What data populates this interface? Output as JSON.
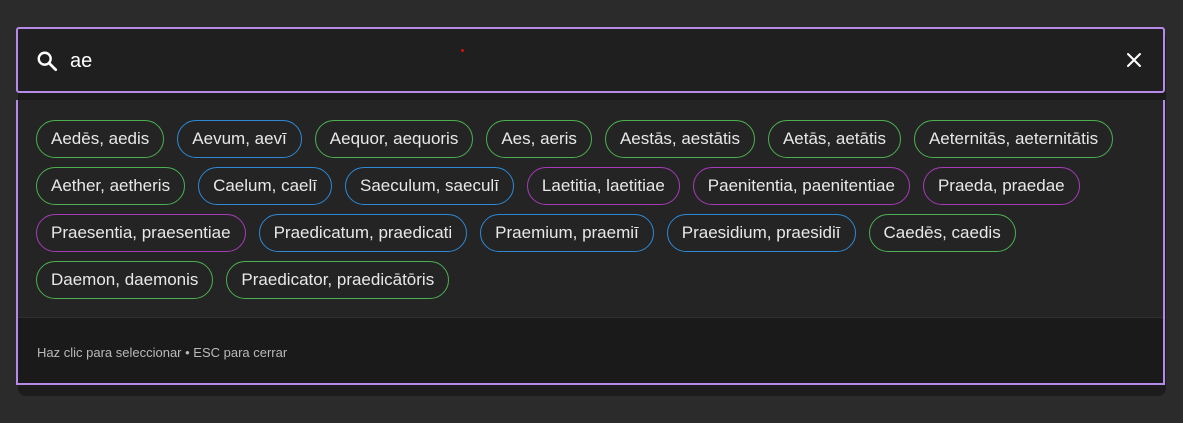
{
  "search": {
    "value": "ae",
    "placeholder": ""
  },
  "icons": {
    "search": "search-icon",
    "clear": "close-icon"
  },
  "colors": {
    "accent_border": "#b58ae8",
    "chip_green": "#4caf50",
    "chip_blue": "#2e88d4",
    "chip_purple": "#a63ab8"
  },
  "results": [
    {
      "label": "Aedēs, aedis",
      "color": "green"
    },
    {
      "label": "Aevum, aevī",
      "color": "blue"
    },
    {
      "label": "Aequor, aequoris",
      "color": "green"
    },
    {
      "label": "Aes, aeris",
      "color": "green"
    },
    {
      "label": "Aestās, aestātis",
      "color": "green"
    },
    {
      "label": "Aetās, aetātis",
      "color": "green"
    },
    {
      "label": "Aeternitās, aeternitātis",
      "color": "green"
    },
    {
      "label": "Aether, aetheris",
      "color": "green"
    },
    {
      "label": "Caelum, caelī",
      "color": "blue"
    },
    {
      "label": "Saeculum, saeculī",
      "color": "blue"
    },
    {
      "label": "Laetitia, laetitiae",
      "color": "purple"
    },
    {
      "label": "Paenitentia, paenitentiae",
      "color": "purple"
    },
    {
      "label": "Praeda, praedae",
      "color": "purple"
    },
    {
      "label": "Praesentia, praesentiae",
      "color": "purple"
    },
    {
      "label": "Praedicatum, praedicati",
      "color": "blue"
    },
    {
      "label": "Praemium, praemiī",
      "color": "blue"
    },
    {
      "label": "Praesidium, praesidiī",
      "color": "blue"
    },
    {
      "label": "Caedēs, caedis",
      "color": "green"
    },
    {
      "label": "Daemon, daemonis",
      "color": "green"
    },
    {
      "label": "Praedicator, praedicātōris",
      "color": "green"
    }
  ],
  "footer": {
    "hint": "Haz clic para seleccionar • ESC para cerrar"
  }
}
